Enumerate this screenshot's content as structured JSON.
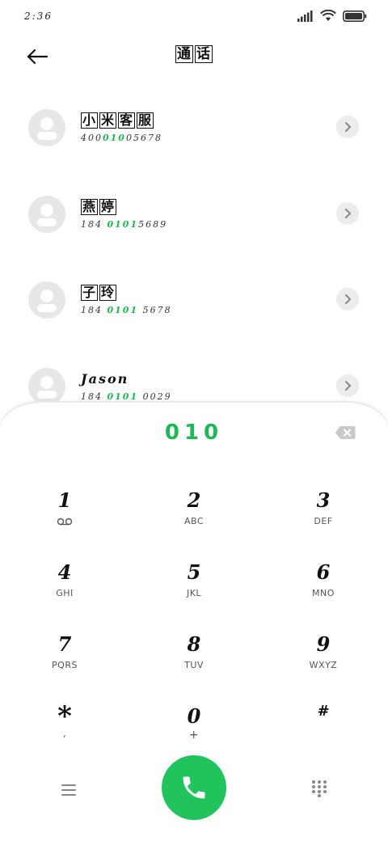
{
  "status": {
    "time": "2:36",
    "icons": [
      "signal-icon",
      "wifi-icon",
      "battery-icon"
    ]
  },
  "header": {
    "title_chars": [
      "通",
      "话"
    ],
    "back_icon": "back-arrow-icon"
  },
  "colors": {
    "accent": "#1db954",
    "call_button": "#21c35d",
    "avatar_bg": "#e7e7ea"
  },
  "contacts": [
    {
      "name_chars": [
        "小",
        "米",
        "客",
        "服"
      ],
      "number_pre": "400",
      "number_match": "010",
      "number_post": "05678"
    },
    {
      "name_chars": [
        "燕",
        "婷"
      ],
      "number_pre": "184 ",
      "number_match": "0101",
      "number_post": "5689"
    },
    {
      "name_chars": [
        "子",
        "玲"
      ],
      "number_pre": "184 ",
      "number_match": "0101",
      "number_post": " 5678"
    },
    {
      "name_text": "Jason",
      "number_pre": "184 ",
      "number_match": "0101",
      "number_post": " 0029"
    }
  ],
  "dialer": {
    "input": "010",
    "keys": [
      {
        "digit": "1",
        "letters": ""
      },
      {
        "digit": "2",
        "letters": "ABC"
      },
      {
        "digit": "3",
        "letters": "DEF"
      },
      {
        "digit": "4",
        "letters": "GHI"
      },
      {
        "digit": "5",
        "letters": "JKL"
      },
      {
        "digit": "6",
        "letters": "MNO"
      },
      {
        "digit": "7",
        "letters": "PQRS"
      },
      {
        "digit": "8",
        "letters": "TUV"
      },
      {
        "digit": "9",
        "letters": "WXYZ"
      },
      {
        "digit": "*",
        "letters": ","
      },
      {
        "digit": "0",
        "letters": "+"
      },
      {
        "digit": "#",
        "letters": ""
      }
    ]
  }
}
